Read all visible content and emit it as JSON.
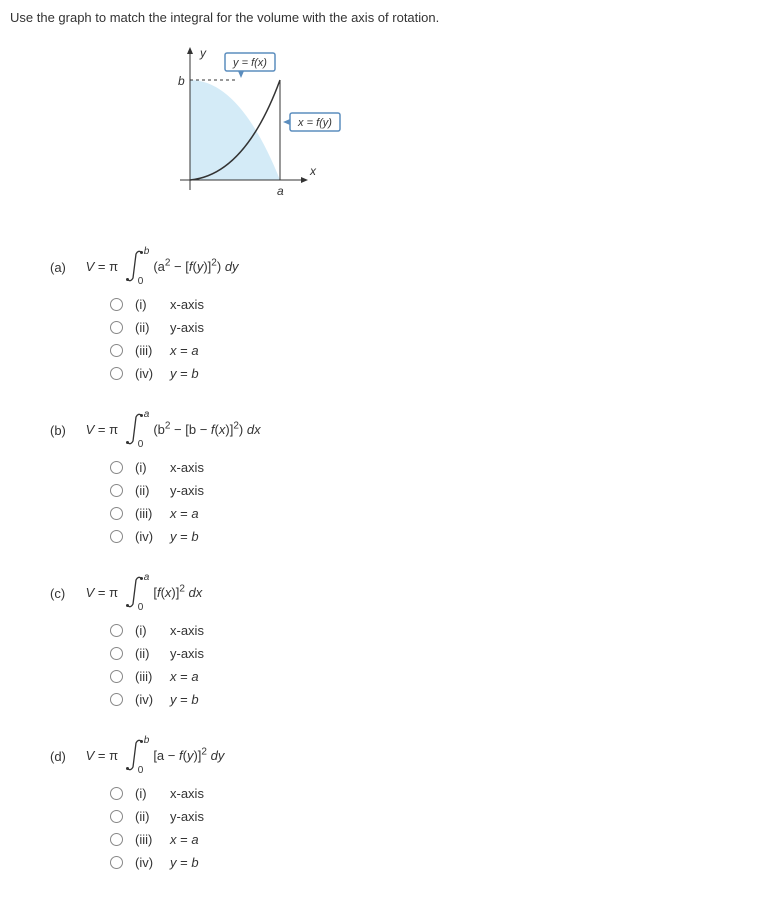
{
  "instruction": "Use the graph to match the integral for the volume with the axis of rotation.",
  "graph": {
    "y_label": "y",
    "x_label": "x",
    "b_label": "b",
    "a_label": "a",
    "func1": "y = f(x)",
    "func2": "x = f(y)"
  },
  "parts": [
    {
      "label": "(a)",
      "prefix": "V = π",
      "upper": "b",
      "lower": "0",
      "integrand_html": " (a<span class='sq'>2</span> − [<span class='italic'>f</span>(<span class='italic'>y</span>)]<span class='sq'>2</span>) <span class='italic'>dy</span>"
    },
    {
      "label": "(b)",
      "prefix": "V = π",
      "upper": "a",
      "lower": "0",
      "integrand_html": " (b<span class='sq'>2</span> − [b − <span class='italic'>f</span>(<span class='italic'>x</span>)]<span class='sq'>2</span>) <span class='italic'>dx</span>"
    },
    {
      "label": "(c)",
      "prefix": "V = π",
      "upper": "a",
      "lower": "0",
      "integrand_html": " [<span class='italic'>f</span>(<span class='italic'>x</span>)]<span class='sq'>2</span> <span class='italic'>dx</span>"
    },
    {
      "label": "(d)",
      "prefix": "V = π",
      "upper": "b",
      "lower": "0",
      "integrand_html": " [a − <span class='italic'>f</span>(<span class='italic'>y</span>)]<span class='sq'>2</span> <span class='italic'>dy</span>"
    }
  ],
  "options": [
    {
      "num": "(i)",
      "label": "x-axis"
    },
    {
      "num": "(ii)",
      "label": "y-axis"
    },
    {
      "num": "(iii)",
      "label": "x = a"
    },
    {
      "num": "(iv)",
      "label": "y = b"
    }
  ]
}
